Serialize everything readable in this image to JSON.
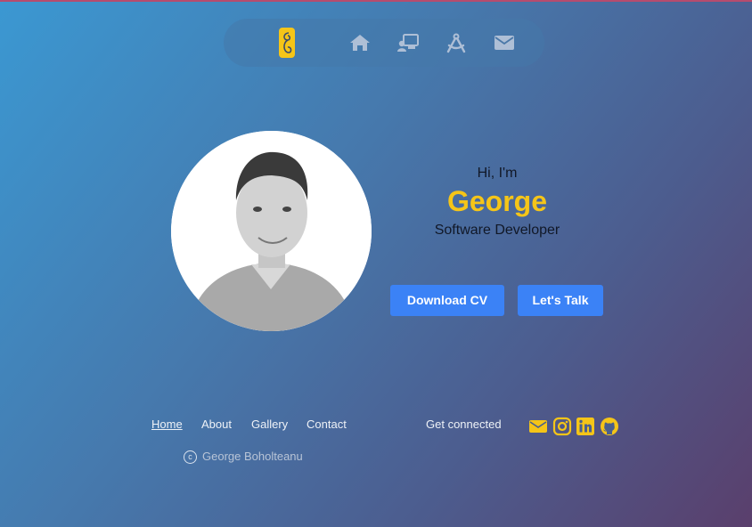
{
  "nav": {
    "items": [
      {
        "icon": "home-icon"
      },
      {
        "icon": "presentation-user-icon"
      },
      {
        "icon": "compass-drafting-icon"
      },
      {
        "icon": "envelope-icon"
      }
    ],
    "logo_icon": "logo-b-icon"
  },
  "hero": {
    "greeting": "Hi, I'm",
    "name": "George",
    "role": "Software Developer",
    "download_cv_label": "Download CV",
    "lets_talk_label": "Let's Talk"
  },
  "footer": {
    "links": [
      "Home",
      "About",
      "Gallery",
      "Contact"
    ],
    "active_link": "Home",
    "connected_label": "Get connected",
    "social": [
      "envelope-icon",
      "instagram-icon",
      "linkedin-icon",
      "github-icon"
    ],
    "copyright_name": "George Boholteanu"
  },
  "colors": {
    "accent_yellow": "#f5c518",
    "button_blue": "#3b82f6",
    "gradient_start": "#3b98d2",
    "gradient_end": "#5a3f6c"
  }
}
